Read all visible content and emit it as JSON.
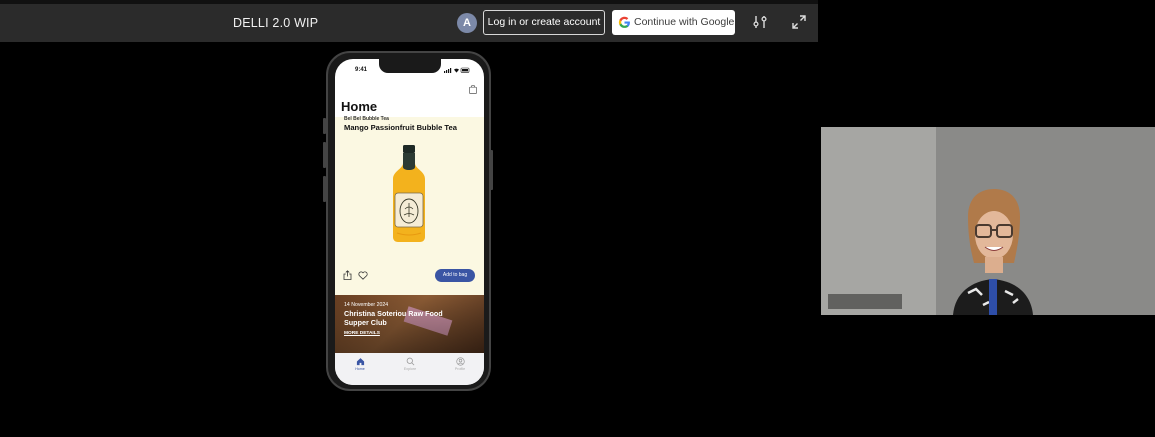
{
  "app": {
    "title": "DELLI 2.0 WIP"
  },
  "auth": {
    "avatar_letter": "A",
    "login_label": "Log in or create account",
    "google_label": "Continue with Google"
  },
  "toolbar_icons": [
    "tune-icon",
    "expand-icon"
  ],
  "phone": {
    "status_time": "9:41",
    "page_title": "Home",
    "featured": {
      "subtitle": "Bel Bel Bubble Tea",
      "title": "Mango Passionfruit Bubble Tea",
      "add_button": "Add to bag"
    },
    "event": {
      "date": "14 November 2024",
      "title": "Christina Soteriou Raw Food Supper Club",
      "link": "MORE DETAILS"
    },
    "tabs": [
      {
        "label": "Home",
        "icon": "home-icon",
        "active": true
      },
      {
        "label": "Explore",
        "icon": "search-icon",
        "active": false
      },
      {
        "label": "Profile",
        "icon": "profile-icon",
        "active": false
      }
    ]
  },
  "colors": {
    "topbar": "#2b2b2b",
    "accent": "#3a55a4",
    "card_bg": "#fbf8e2"
  }
}
